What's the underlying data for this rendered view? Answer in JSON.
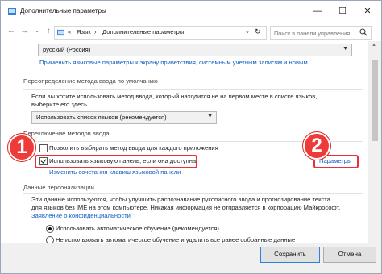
{
  "window": {
    "title": "Дополнительные параметры",
    "controls": {
      "minimize": "—",
      "maximize": "☐",
      "close": "✕"
    }
  },
  "address_bar": {
    "breadcrumb_prefix": "«",
    "crumbs": [
      "Язык",
      "Дополнительные параметры"
    ],
    "separator": "›",
    "search_placeholder": "Поиск в панели управления"
  },
  "top": {
    "language_combo": "русский (Россия)",
    "apply_link": "Применить языковые параметры к экрану приветствия, системным учетным записям и новым"
  },
  "default_input": {
    "heading": "Переопределение метода ввода по умолчанию",
    "line1": "Если вы хотите использовать метод ввода, который находится не на первом месте в списке языков,",
    "line2": "выберите его здесь.",
    "combo": "Использовать список языков (рекомендуется)"
  },
  "switching": {
    "heading": "Переключение методов ввода",
    "per_app_checkbox": "Позволить выбирать метод ввода для каждого приложения",
    "per_app_checked": false,
    "langbar_checkbox": "Использовать языковую панель, если она доступна",
    "langbar_checked": true,
    "options_link": "Параметры",
    "hotkeys_link": "Изменить сочетания клавиш языковой панели"
  },
  "personal": {
    "heading": "Данные персонализации",
    "line1": "Эти данные используются, чтобы улучшить распознавание рукописного ввода и прогнозирование текста",
    "line2": "для языков без IME на этом компьютере. Никакая информация не отправляется в корпорацию Майкрософт.",
    "privacy_link": "Заявление о конфиденциальности",
    "radio_auto": "Использовать автоматическое обучение (рекомендуется)",
    "radio_auto_selected": true,
    "radio_no": "Не использовать автоматическое обучение и удалить все ранее собранные данные"
  },
  "callouts": {
    "one": "1",
    "two": "2"
  },
  "footer": {
    "save": "Сохранить",
    "cancel": "Отмена"
  },
  "colors": {
    "link": "#0d5fbf",
    "callout": "#ef3a3a",
    "highlight": "#e8303a"
  }
}
